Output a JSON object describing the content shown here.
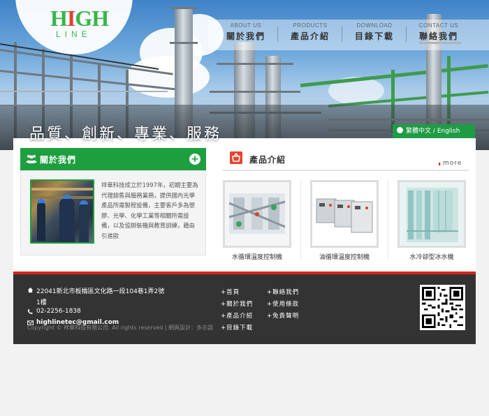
{
  "header": {
    "logo_text_main": "HIGH",
    "logo_text_sub": "LINE",
    "nav": [
      {
        "en": "ABOUT US",
        "zh": "關於我們"
      },
      {
        "en": "PRODUCTS",
        "zh": "產品介紹"
      },
      {
        "en": "DOWNLOAD",
        "zh": "目錄下載"
      },
      {
        "en": "CONTACT US",
        "zh": "聯絡我們"
      }
    ],
    "slogan": "品質、創新、專業、服務",
    "lang_zh": "繁體中文",
    "lang_sep": "/",
    "lang_en": "English"
  },
  "about": {
    "title": "關於我們",
    "text": "祥華科技成立於1997年，初期主要為代理銷售與服務業務，提供國內光學產品所需製程設備，主要客戶多為塑膠、光學、化學工業等相關所需設備，以及協辦裝機與教育訓練，藉由引進歐"
  },
  "products": {
    "title": "產品介紹",
    "more": "more",
    "items": [
      {
        "caption": "水循環溫度控制機"
      },
      {
        "caption": "油循環溫度控制機"
      },
      {
        "caption": "水冷卻型冰水機"
      }
    ]
  },
  "footer": {
    "address_line1": "22041新北市板橋區文化路一段104巷1弄2號",
    "address_line2": "1樓",
    "phone": "02-2256-1838",
    "email": "highlinetec@gmail.com",
    "copyright": "Copyright © 祥華科技有限公司. All rights reserved | 網頁設計：多示語",
    "links_col1": [
      "首頁",
      "關於我們",
      "產品介紹",
      "目錄下載"
    ],
    "links_col2": [
      "聯絡我們",
      "使用條款",
      "免責聲明"
    ],
    "link_prefix": "+"
  },
  "colors": {
    "brand_green": "#1e9f3f",
    "accent_red": "#d9231f",
    "footer_bg": "#333333"
  }
}
